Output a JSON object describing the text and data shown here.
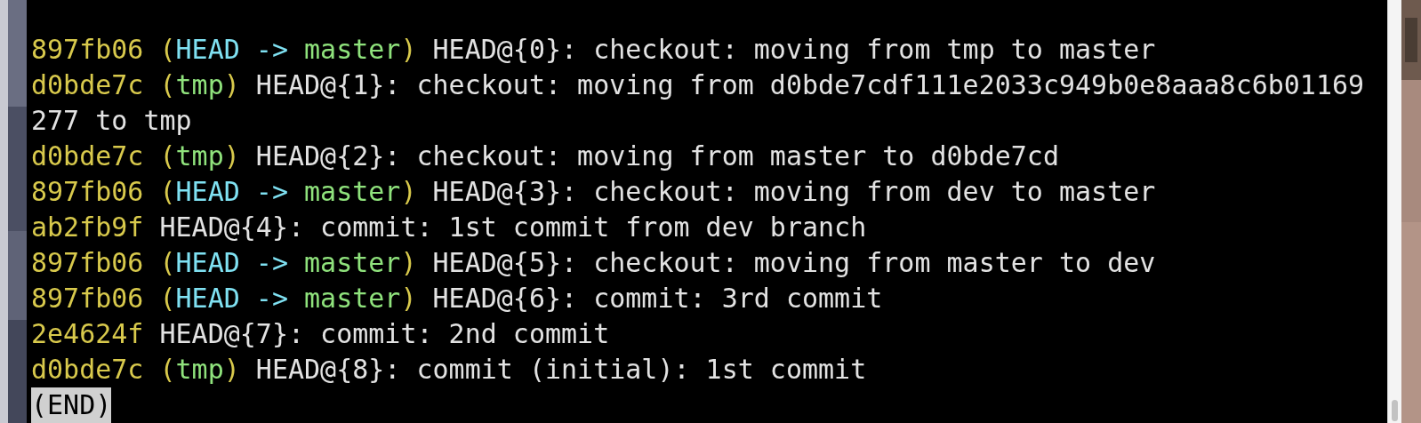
{
  "terminal": {
    "lines": [
      {
        "segments": [
          {
            "kind": "hash",
            "text": "897fb06"
          },
          {
            "kind": "paren",
            "text": " ("
          },
          {
            "kind": "head",
            "text": "HEAD -> "
          },
          {
            "kind": "branch",
            "text": "master"
          },
          {
            "kind": "paren",
            "text": ")"
          },
          {
            "kind": "text",
            "text": " HEAD@{0}: checkout: moving from tmp to master"
          }
        ]
      },
      {
        "segments": [
          {
            "kind": "hash",
            "text": "d0bde7c"
          },
          {
            "kind": "paren",
            "text": " ("
          },
          {
            "kind": "branch",
            "text": "tmp"
          },
          {
            "kind": "paren",
            "text": ")"
          },
          {
            "kind": "text",
            "text": " HEAD@{1}: checkout: moving from d0bde7cdf111e2033c949b0e8aaa8c6b01169"
          }
        ]
      },
      {
        "segments": [
          {
            "kind": "text",
            "text": "277 to tmp"
          }
        ]
      },
      {
        "segments": [
          {
            "kind": "hash",
            "text": "d0bde7c"
          },
          {
            "kind": "paren",
            "text": " ("
          },
          {
            "kind": "branch",
            "text": "tmp"
          },
          {
            "kind": "paren",
            "text": ")"
          },
          {
            "kind": "text",
            "text": " HEAD@{2}: checkout: moving from master to d0bde7cd"
          }
        ]
      },
      {
        "segments": [
          {
            "kind": "hash",
            "text": "897fb06"
          },
          {
            "kind": "paren",
            "text": " ("
          },
          {
            "kind": "head",
            "text": "HEAD -> "
          },
          {
            "kind": "branch",
            "text": "master"
          },
          {
            "kind": "paren",
            "text": ")"
          },
          {
            "kind": "text",
            "text": " HEAD@{3}: checkout: moving from dev to master"
          }
        ]
      },
      {
        "segments": [
          {
            "kind": "hash",
            "text": "ab2fb9f"
          },
          {
            "kind": "text",
            "text": " HEAD@{4}: commit: 1st commit from dev branch"
          }
        ]
      },
      {
        "segments": [
          {
            "kind": "hash",
            "text": "897fb06"
          },
          {
            "kind": "paren",
            "text": " ("
          },
          {
            "kind": "head",
            "text": "HEAD -> "
          },
          {
            "kind": "branch",
            "text": "master"
          },
          {
            "kind": "paren",
            "text": ")"
          },
          {
            "kind": "text",
            "text": " HEAD@{5}: checkout: moving from master to dev"
          }
        ]
      },
      {
        "segments": [
          {
            "kind": "hash",
            "text": "897fb06"
          },
          {
            "kind": "paren",
            "text": " ("
          },
          {
            "kind": "head",
            "text": "HEAD -> "
          },
          {
            "kind": "branch",
            "text": "master"
          },
          {
            "kind": "paren",
            "text": ")"
          },
          {
            "kind": "text",
            "text": " HEAD@{6}: commit: 3rd commit"
          }
        ]
      },
      {
        "segments": [
          {
            "kind": "hash",
            "text": "2e4624f"
          },
          {
            "kind": "text",
            "text": " HEAD@{7}: commit: 2nd commit"
          }
        ]
      },
      {
        "segments": [
          {
            "kind": "hash",
            "text": "d0bde7c"
          },
          {
            "kind": "paren",
            "text": " ("
          },
          {
            "kind": "branch",
            "text": "tmp"
          },
          {
            "kind": "paren",
            "text": ")"
          },
          {
            "kind": "text",
            "text": " HEAD@{8}: commit (initial): 1st commit"
          }
        ]
      }
    ],
    "pager_prompt": "(END)"
  }
}
